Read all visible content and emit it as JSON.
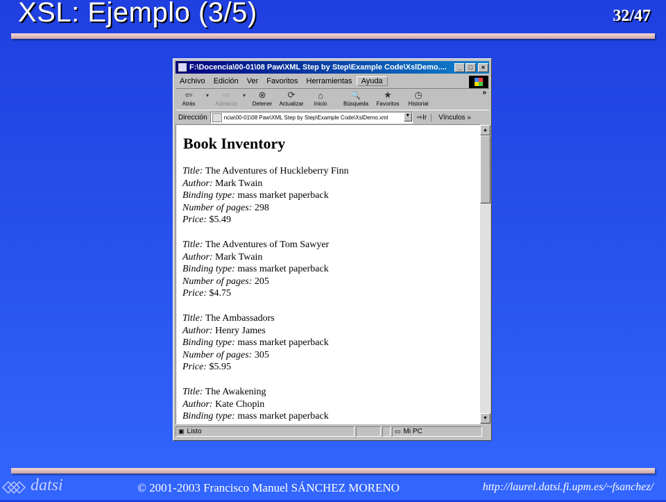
{
  "slide": {
    "title": "XSL: Ejemplo (3/5)",
    "page_number": "32/47",
    "footer_left": "© 2001-2003 Francisco Manuel SÁNCHEZ MORENO",
    "footer_right": "http://laurel.datsi.fi.upm.es/~fsanchez/",
    "logo_text": "datsi"
  },
  "window": {
    "title": "F:\\Docencia\\00-01\\08 Paw\\XML Step by Step\\Example Code\\XslDemo....",
    "buttons": [
      "_",
      "□",
      "×"
    ],
    "menu": [
      "Archivo",
      "Edición",
      "Ver",
      "Favoritos",
      "Herramientas",
      "Ayuda"
    ],
    "toolbar": [
      {
        "label": "Atrás",
        "icon": "back-arrow-icon",
        "glyph": "⇦"
      },
      {
        "label": "Adelante",
        "icon": "forward-arrow-icon",
        "glyph": "⇨"
      },
      {
        "label": "Detener",
        "icon": "stop-icon",
        "glyph": "⊗"
      },
      {
        "label": "Actualizar",
        "icon": "refresh-icon",
        "glyph": "⟳"
      },
      {
        "label": "Inicio",
        "icon": "home-icon",
        "glyph": "⌂"
      },
      {
        "label": "Búsqueda",
        "icon": "search-icon",
        "glyph": "🔍"
      },
      {
        "label": "Favoritos",
        "icon": "favorites-icon",
        "glyph": "★"
      },
      {
        "label": "Historial",
        "icon": "history-icon",
        "glyph": "◷"
      }
    ],
    "address_label": "Dirección",
    "address_value": "ncia\\00-01\\08 Paw\\XML Step by Step\\Example Code\\XslDemo.xml",
    "go_label": "Ir",
    "links_label": "Vínculos",
    "status_text": "Listo",
    "status_zone": "Mi PC"
  },
  "document": {
    "heading": "Book Inventory",
    "field_labels": {
      "title": "Title:",
      "author": "Author:",
      "binding": "Binding type:",
      "pages": "Number of pages:",
      "price": "Price:"
    },
    "books": [
      {
        "title": "The Adventures of Huckleberry Finn",
        "author": "Mark Twain",
        "binding": "mass market paperback",
        "pages": "298",
        "price": "$5.49"
      },
      {
        "title": "The Adventures of Tom Sawyer",
        "author": "Mark Twain",
        "binding": "mass market paperback",
        "pages": "205",
        "price": "$4.75"
      },
      {
        "title": "The Ambassadors",
        "author": "Henry James",
        "binding": "mass market paperback",
        "pages": "305",
        "price": "$5.95"
      },
      {
        "title": "The Awakening",
        "author": "Kate Chopin",
        "binding": "mass market paperback"
      }
    ]
  }
}
